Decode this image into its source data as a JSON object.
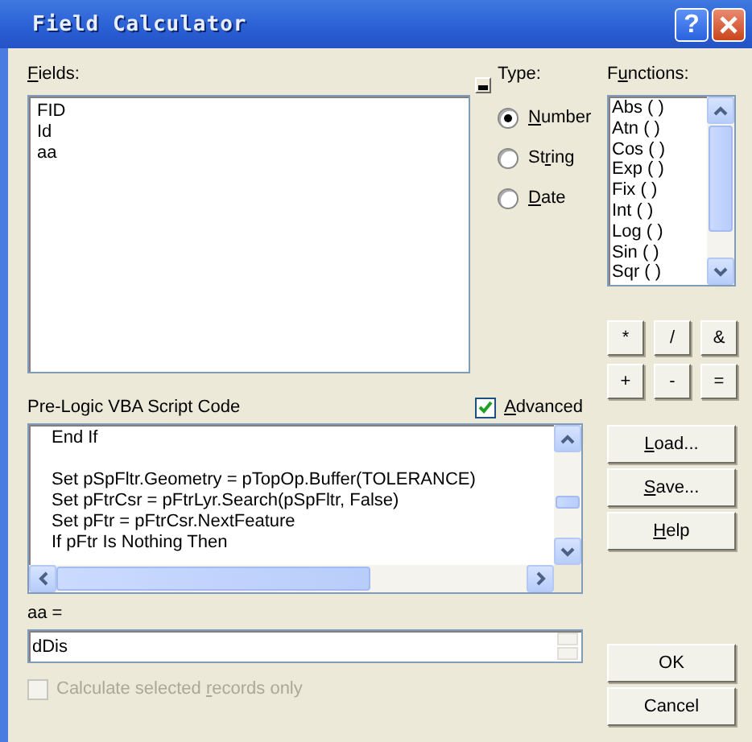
{
  "window": {
    "title": "Field Calculator",
    "help_label": "?"
  },
  "fields": {
    "label": {
      "key": "F",
      "after": "ields:"
    },
    "items": [
      "FID",
      "Id",
      "aa"
    ]
  },
  "type": {
    "label": "Type:",
    "options": [
      {
        "label": {
          "key": "N",
          "after": "umber"
        },
        "selected": true
      },
      {
        "label": {
          "before": "St",
          "key": "r",
          "after": "ing"
        },
        "selected": false
      },
      {
        "label": {
          "key": "D",
          "after": "ate"
        },
        "selected": false
      }
    ]
  },
  "functions": {
    "label": {
      "before": "F",
      "key": "u",
      "after": "nctions:"
    },
    "items": [
      "Abs ( )",
      "Atn ( )",
      "Cos ( )",
      "Exp ( )",
      "Fix ( )",
      "Int ( )",
      "Log ( )",
      "Sin ( )",
      "Sqr ( )"
    ]
  },
  "operators": [
    "*",
    "/",
    "&",
    "+",
    "-",
    "="
  ],
  "prelogic": {
    "label": "Pre-Logic VBA Script Code",
    "advanced": {
      "label": {
        "key": "A",
        "after": "dvanced"
      },
      "checked": true
    },
    "lines": [
      {
        "kind": "code",
        "text": "End If"
      },
      {
        "kind": "blank"
      },
      {
        "kind": "code",
        "text": "Set pSpFltr.Geometry = pTopOp.Buffer(TOLERANCE)"
      },
      {
        "kind": "code",
        "text": "Set pFtrCsr = pFtrLyr.Search(pSpFltr, False)"
      },
      {
        "kind": "code",
        "text": "Set pFtr = pFtrCsr.NextFeature"
      },
      {
        "kind": "code",
        "text": "If pFtr Is Nothing Then"
      }
    ]
  },
  "side_buttons": [
    {
      "label": {
        "key": "L",
        "after": "oad..."
      }
    },
    {
      "label": {
        "key": "S",
        "after": "ave..."
      }
    },
    {
      "label": {
        "key": "H",
        "after": "elp"
      }
    }
  ],
  "expression": {
    "label": "aa =",
    "value": "dDis"
  },
  "selected_only": {
    "label": {
      "before": "Calculate selected ",
      "key": "r",
      "after": "ecords only"
    },
    "checked": false,
    "disabled": true
  },
  "dialog_buttons": [
    "OK",
    "Cancel"
  ]
}
